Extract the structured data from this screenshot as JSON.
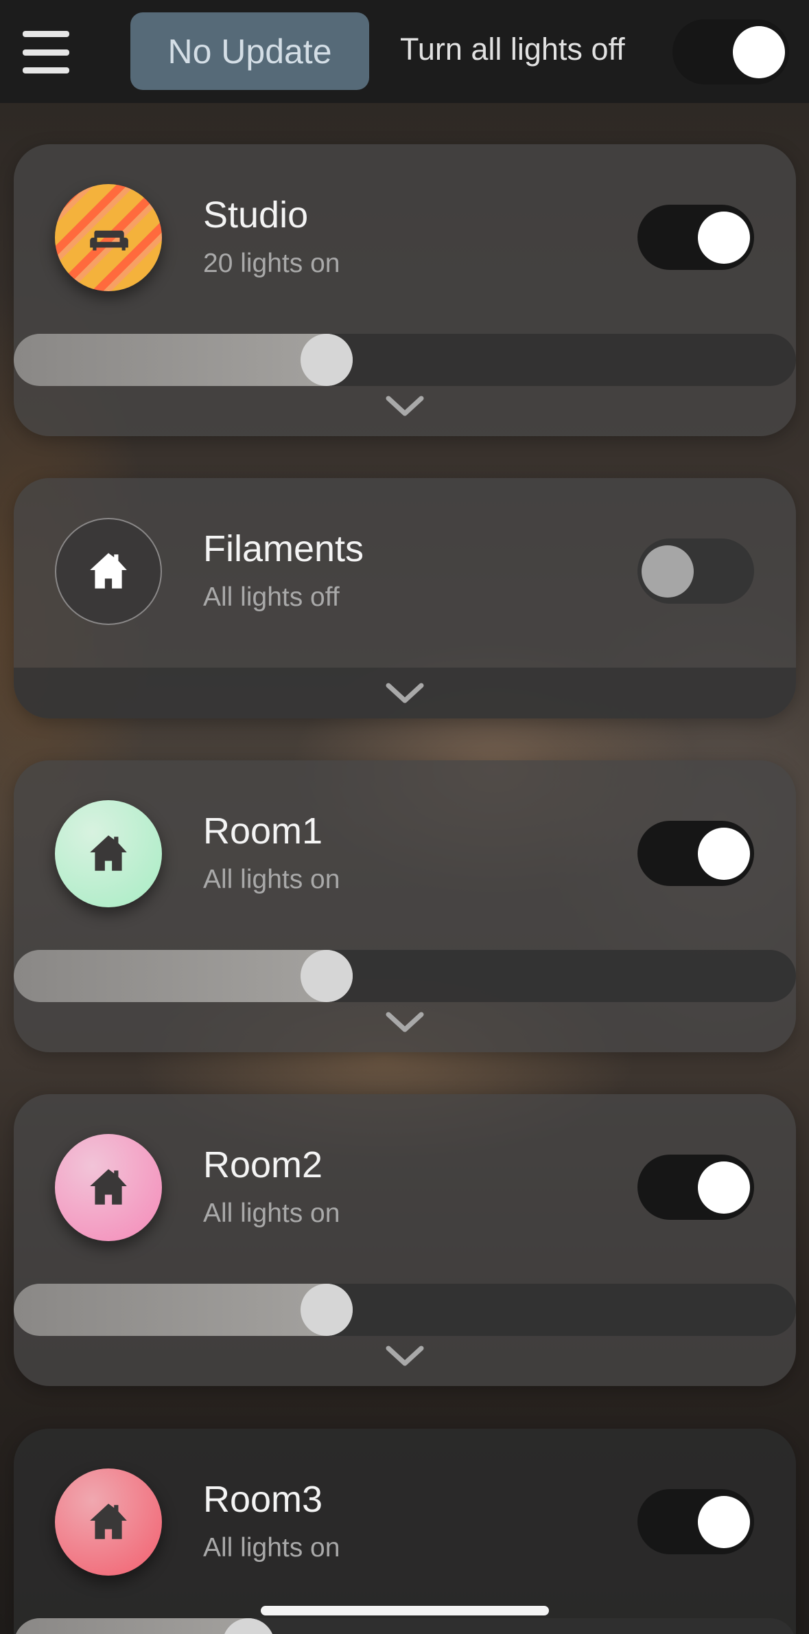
{
  "header": {
    "menu_icon": "hamburger-menu-icon",
    "update_button_label": "No Update",
    "all_lights_off_label": "Turn all lights off",
    "master_toggle_on": true
  },
  "rooms": [
    {
      "name": "Studio",
      "status": "20 lights on",
      "icon": "sofa-icon",
      "icon_colors": [
        "#f4b23c",
        "#ff6a3d"
      ],
      "on": true,
      "brightness": 0.4,
      "expand_icon": "chevron-down-icon"
    },
    {
      "name": "Filaments",
      "status": "All lights off",
      "icon": "house-icon",
      "icon_colors": [
        "#3a3838",
        "#3a3838"
      ],
      "on": false,
      "expand_icon": "chevron-down-icon"
    },
    {
      "name": "Room1",
      "status": "All lights on",
      "icon": "house-icon",
      "icon_colors": [
        "#a8ecc4",
        "#d8f2e0"
      ],
      "on": true,
      "brightness": 0.4,
      "expand_icon": "chevron-down-icon"
    },
    {
      "name": "Room2",
      "status": "All lights on",
      "icon": "house-icon",
      "icon_colors": [
        "#f48ab8",
        "#f2c4d8"
      ],
      "on": true,
      "brightness": 0.4,
      "expand_icon": "chevron-down-icon"
    },
    {
      "name": "Room3",
      "status": "All lights on",
      "icon": "house-icon",
      "icon_colors": [
        "#f25f6e",
        "#f0a8b0"
      ],
      "on": true,
      "brightness": 0.3
    }
  ],
  "colors": {
    "update_button_bg": "#566a78",
    "toggle_track": "#161616",
    "toggle_knob": "#ffffff"
  }
}
